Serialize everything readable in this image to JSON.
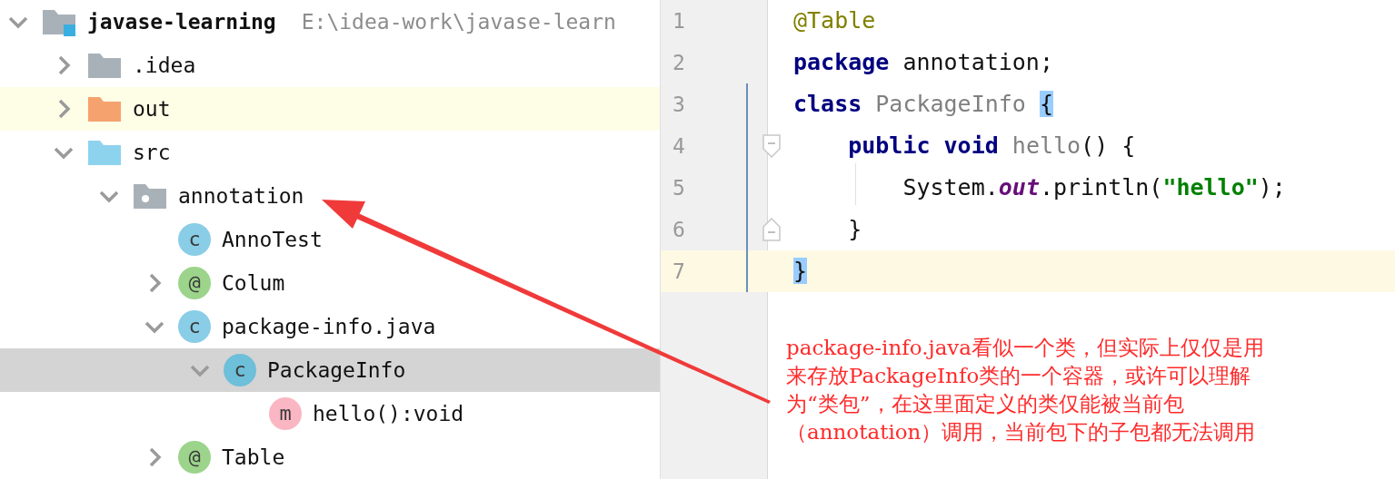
{
  "project_tree": {
    "root": {
      "label": "javase-learning",
      "path": "E:\\idea-work\\javase-learn",
      "kind": "module",
      "expanded": true,
      "selected": false,
      "highlighted": false,
      "children": [
        {
          "label": ".idea",
          "kind": "folder",
          "expanded": false,
          "selected": false,
          "highlighted": false
        },
        {
          "label": "out",
          "kind": "excluded_folder",
          "expanded": false,
          "selected": false,
          "highlighted": true
        },
        {
          "label": "src",
          "kind": "source_folder",
          "expanded": true,
          "selected": false,
          "highlighted": false,
          "children": [
            {
              "label": "annotation",
              "kind": "package",
              "expanded": true,
              "selected": false,
              "highlighted": false,
              "children": [
                {
                  "label": "AnnoTest",
                  "kind": "class",
                  "badge": "c",
                  "selected": false,
                  "highlighted": false
                },
                {
                  "label": "Colum",
                  "kind": "annotation",
                  "badge": "@",
                  "expanded": false,
                  "selected": false,
                  "highlighted": false
                },
                {
                  "label": "package-info.java",
                  "kind": "class",
                  "badge": "c",
                  "expanded": true,
                  "selected": false,
                  "highlighted": false,
                  "children": [
                    {
                      "label": "PackageInfo",
                      "kind": "class",
                      "badge": "c",
                      "expanded": true,
                      "selected": true,
                      "highlighted": false,
                      "children": [
                        {
                          "label": "hello():void",
                          "kind": "method",
                          "badge": "m",
                          "selected": false,
                          "highlighted": false
                        }
                      ]
                    }
                  ]
                },
                {
                  "label": "Table",
                  "kind": "annotation",
                  "badge": "@",
                  "expanded": false,
                  "selected": false,
                  "highlighted": false
                }
              ]
            }
          ]
        }
      ]
    }
  },
  "editor": {
    "lines": [
      {
        "number": "1",
        "kind": "code",
        "current": false,
        "tokens": [
          {
            "kind": "annotation",
            "text": "@Table"
          }
        ]
      },
      {
        "number": "2",
        "kind": "code",
        "current": false,
        "tokens": [
          {
            "kind": "keyword",
            "text": "package"
          },
          {
            "kind": "plain",
            "text": " annotation;"
          }
        ]
      },
      {
        "number": "3",
        "kind": "code",
        "current": false,
        "tokens": [
          {
            "kind": "keyword",
            "text": "class"
          },
          {
            "kind": "unused",
            "text": " PackageInfo "
          },
          {
            "kind": "brace_match",
            "text": "{"
          }
        ]
      },
      {
        "number": "4",
        "kind": "fold_start",
        "current": false,
        "tokens": [
          {
            "kind": "keyword",
            "text": "    public void"
          },
          {
            "kind": "unused",
            "text": " hello"
          },
          {
            "kind": "plain",
            "text": "() {"
          }
        ]
      },
      {
        "number": "5",
        "kind": "indented",
        "current": false,
        "tokens": [
          {
            "kind": "plain",
            "text": "        System."
          },
          {
            "kind": "static_field",
            "text": "out"
          },
          {
            "kind": "plain",
            "text": ".println("
          },
          {
            "kind": "string",
            "text": "\"hello\""
          },
          {
            "kind": "plain",
            "text": ");"
          }
        ]
      },
      {
        "number": "6",
        "kind": "fold_end",
        "current": false,
        "tokens": [
          {
            "kind": "plain",
            "text": "    }"
          }
        ]
      },
      {
        "number": "7",
        "kind": "code",
        "current": true,
        "tokens": [
          {
            "kind": "brace_match",
            "text": "}"
          }
        ]
      }
    ]
  },
  "note": {
    "lines": [
      "package-info.java看似一个类，但实际上仅仅是用",
      "来存放PackageInfo类的一个容器，或许可以理解",
      "为“类包”，在这里面定义的类仅能被当前包",
      "（annotation）调用，当前包下的子包都无法调用"
    ]
  }
}
